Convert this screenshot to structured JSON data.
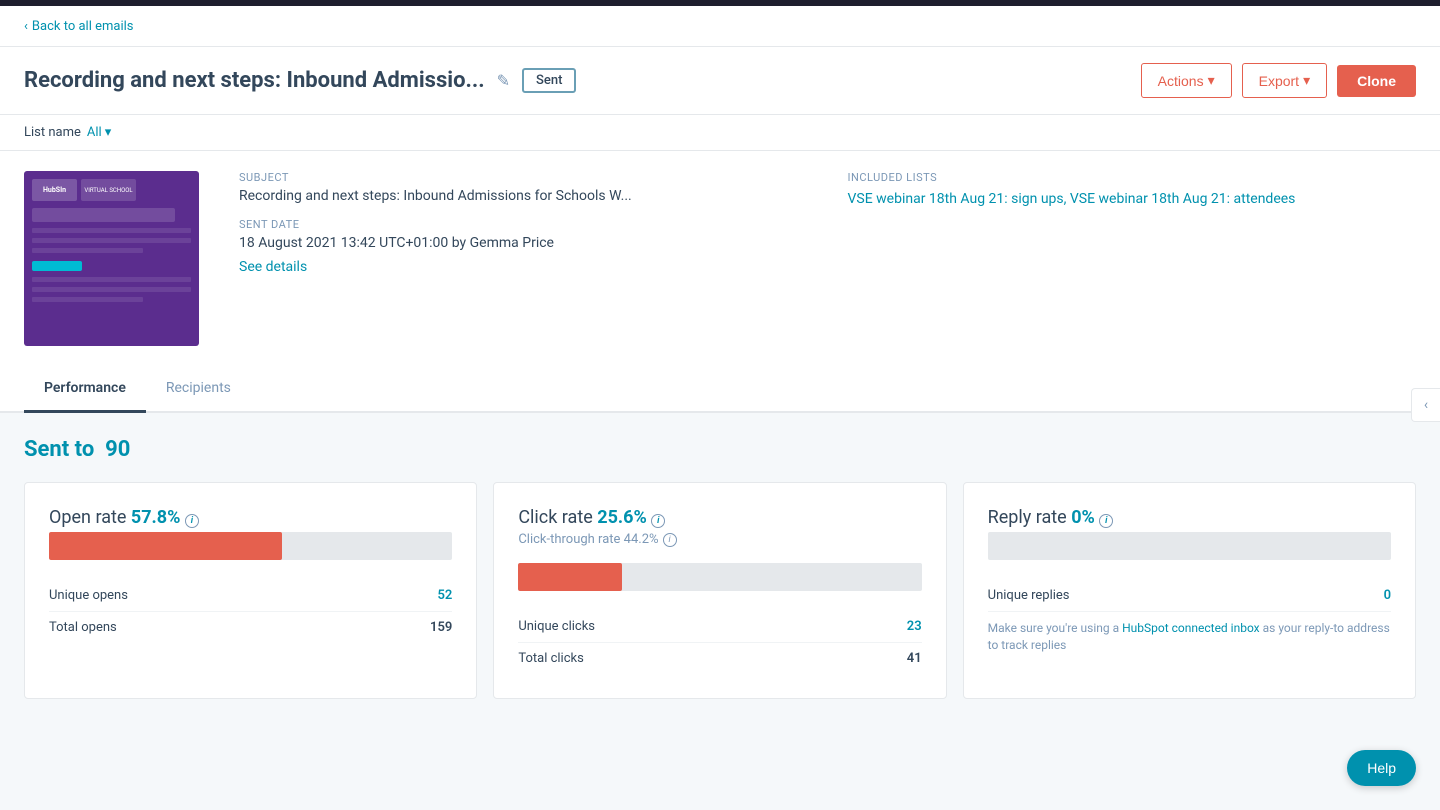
{
  "topNav": {
    "backLabel": "Back to all emails"
  },
  "header": {
    "title": "Recording and next steps: Inbound Admissio...",
    "statusBadge": "Sent",
    "actions": {
      "actionsBtn": "Actions",
      "exportBtn": "Export",
      "cloneBtn": "Clone"
    }
  },
  "listNameBar": {
    "label": "List name",
    "value": "All"
  },
  "emailDetail": {
    "subjectLabel": "Subject",
    "subjectValue": "Recording and next steps: Inbound Admissions for Schools W...",
    "sentDateLabel": "Sent date",
    "sentDateValue": "18 August 2021 13:42 UTC+01:00 by Gemma Price",
    "seeDetails": "See details",
    "includedListsLabel": "Included lists",
    "includedListsValue": "VSE webinar 18th Aug 21: sign ups, VSE webinar 18th Aug 21: attendees"
  },
  "tabs": [
    {
      "label": "Performance",
      "active": true
    },
    {
      "label": "Recipients",
      "active": false
    }
  ],
  "performance": {
    "sentToLabel": "Sent to",
    "sentToValue": "90",
    "metrics": [
      {
        "title": "Open rate",
        "titleValue": "57.8%",
        "subtitle": null,
        "progressPercent": 57.8,
        "rows": [
          {
            "label": "Unique opens",
            "value": "52",
            "isHighlight": true
          },
          {
            "label": "Total opens",
            "value": "159",
            "isHighlight": false
          }
        ]
      },
      {
        "title": "Click rate",
        "titleValue": "25.6%",
        "subtitle": "Click-through rate 44.2%",
        "progressPercent": 25.6,
        "rows": [
          {
            "label": "Unique clicks",
            "value": "23",
            "isHighlight": true
          },
          {
            "label": "Total clicks",
            "value": "41",
            "isHighlight": false
          }
        ]
      },
      {
        "title": "Reply rate",
        "titleValue": "0%",
        "subtitle": null,
        "progressPercent": 0,
        "rows": [
          {
            "label": "Unique replies",
            "value": "0",
            "isHighlight": true
          },
          {
            "label": "hubspotNote",
            "value": "Make sure you're using a HubSpot connected inbox as your reply-to address to track replies",
            "isHighlight": false
          }
        ]
      }
    ]
  },
  "helpButton": "Help",
  "icons": {
    "chevronLeft": "‹",
    "pencil": "✎",
    "caretDown": "▾",
    "info": "i",
    "backArrow": "‹"
  }
}
